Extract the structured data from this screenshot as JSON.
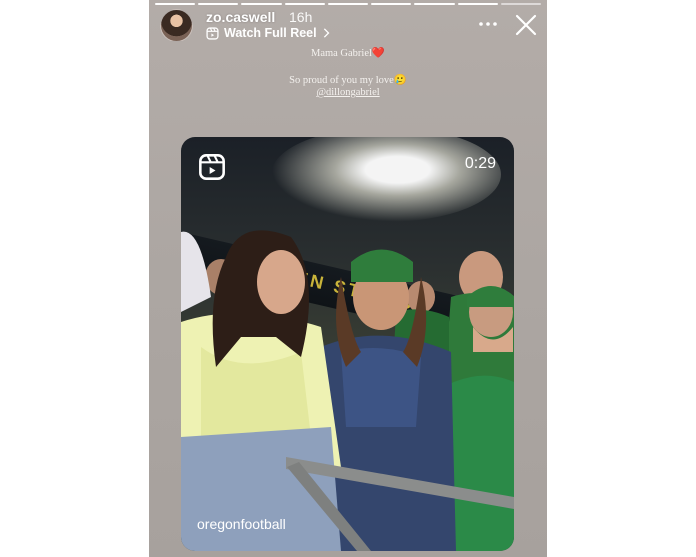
{
  "story": {
    "username": "zo.caswell",
    "time_ago": "16h",
    "watch_label": "Watch Full Reel",
    "progress_segments": [
      1,
      1,
      1,
      1,
      1,
      1,
      1,
      1,
      0
    ]
  },
  "captions": {
    "line1": "Mama Gabriel❤️",
    "line2": "So proud of you my love🥲",
    "mention": "@dillongabriel"
  },
  "reel": {
    "duration": "0:29",
    "banner_text": "AUTZEN STADIUM",
    "account": "oregonfootball"
  },
  "icons": {
    "more": "more-horizontal-icon",
    "close": "close-icon",
    "reel": "reel-play-icon",
    "chevron": "chevron-right-icon"
  }
}
